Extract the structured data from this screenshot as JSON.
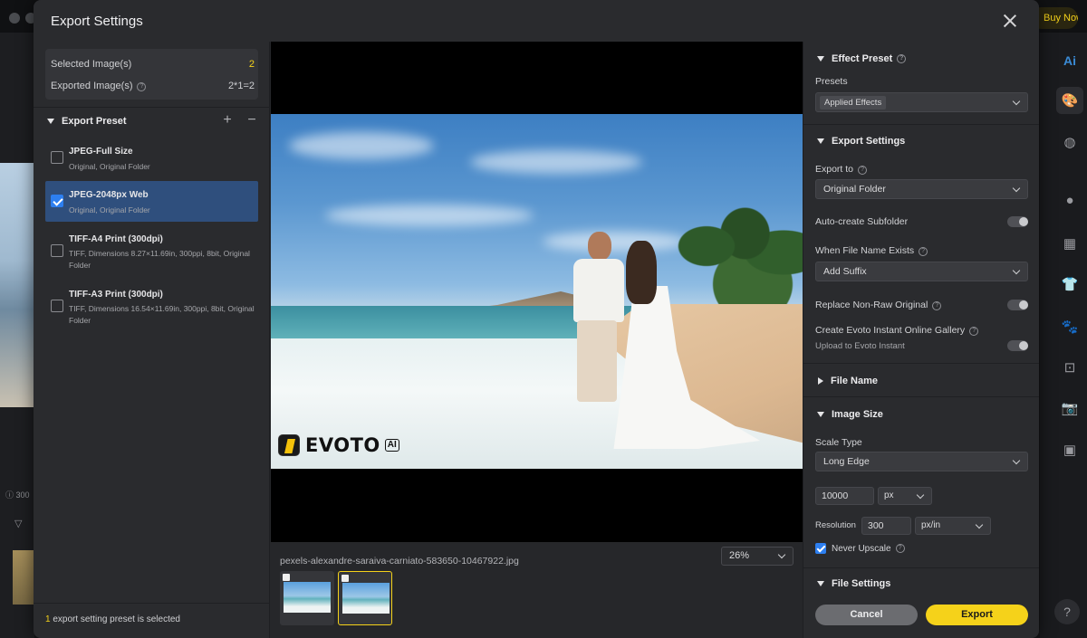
{
  "background_app": {
    "buy_now_label": "Buy Now",
    "left_info_text": "300",
    "accent_color": "#f5d21a"
  },
  "modal": {
    "title": "Export Settings"
  },
  "left_panel": {
    "selected_images_label": "Selected Image(s)",
    "selected_images_value": "2",
    "exported_images_label": "Exported Image(s)",
    "exported_images_value": "2*1=2",
    "export_preset_heading": "Export Preset",
    "presets": [
      {
        "name": "JPEG-Full Size",
        "desc": "Original, Original Folder",
        "checked": false,
        "selected": false
      },
      {
        "name": "JPEG-2048px Web",
        "desc": "Original, Original Folder",
        "checked": true,
        "selected": true
      },
      {
        "name": "TIFF-A4 Print (300dpi)",
        "desc": "TIFF, Dimensions 8.27×11.69in, 300ppi, 8bit, Original Folder",
        "checked": false,
        "selected": false
      },
      {
        "name": "TIFF-A3 Print (300dpi)",
        "desc": "TIFF, Dimensions 16.54×11.69in, 300ppi, 8bit, Original Folder",
        "checked": false,
        "selected": false
      }
    ],
    "footer_count": "1",
    "footer_text": " export setting preset is selected"
  },
  "preview": {
    "watermark_word": "EVOTO",
    "watermark_badge": "AI",
    "filename": "pexels-alexandre-saraiva-carniato-583650-10467922.jpg",
    "zoom_value": "26%",
    "thumbnails": 2,
    "active_thumbnail": 2
  },
  "right_panel": {
    "effect_preset_heading": "Effect Preset",
    "presets_label": "Presets",
    "presets_value": "Applied Effects",
    "export_settings_heading": "Export Settings",
    "export_to_label": "Export to",
    "export_to_value": "Original Folder",
    "auto_subfolder_label": "Auto-create Subfolder",
    "file_exists_label": "When File Name Exists",
    "file_exists_value": "Add Suffix",
    "replace_nonraw_label": "Replace Non-Raw Original",
    "gallery_label": "Create Evoto Instant Online Gallery",
    "gallery_sub": "Upload to Evoto Instant",
    "file_name_heading": "File Name",
    "image_size_heading": "Image Size",
    "scale_type_label": "Scale Type",
    "scale_type_value": "Long Edge",
    "size_value": "10000",
    "size_unit": "px",
    "resolution_label": "Resolution",
    "resolution_value": "300",
    "resolution_unit": "px/in",
    "never_upscale_label": "Never Upscale",
    "never_upscale_checked": true,
    "file_settings_heading": "File Settings",
    "cancel_label": "Cancel",
    "export_label": "Export"
  }
}
